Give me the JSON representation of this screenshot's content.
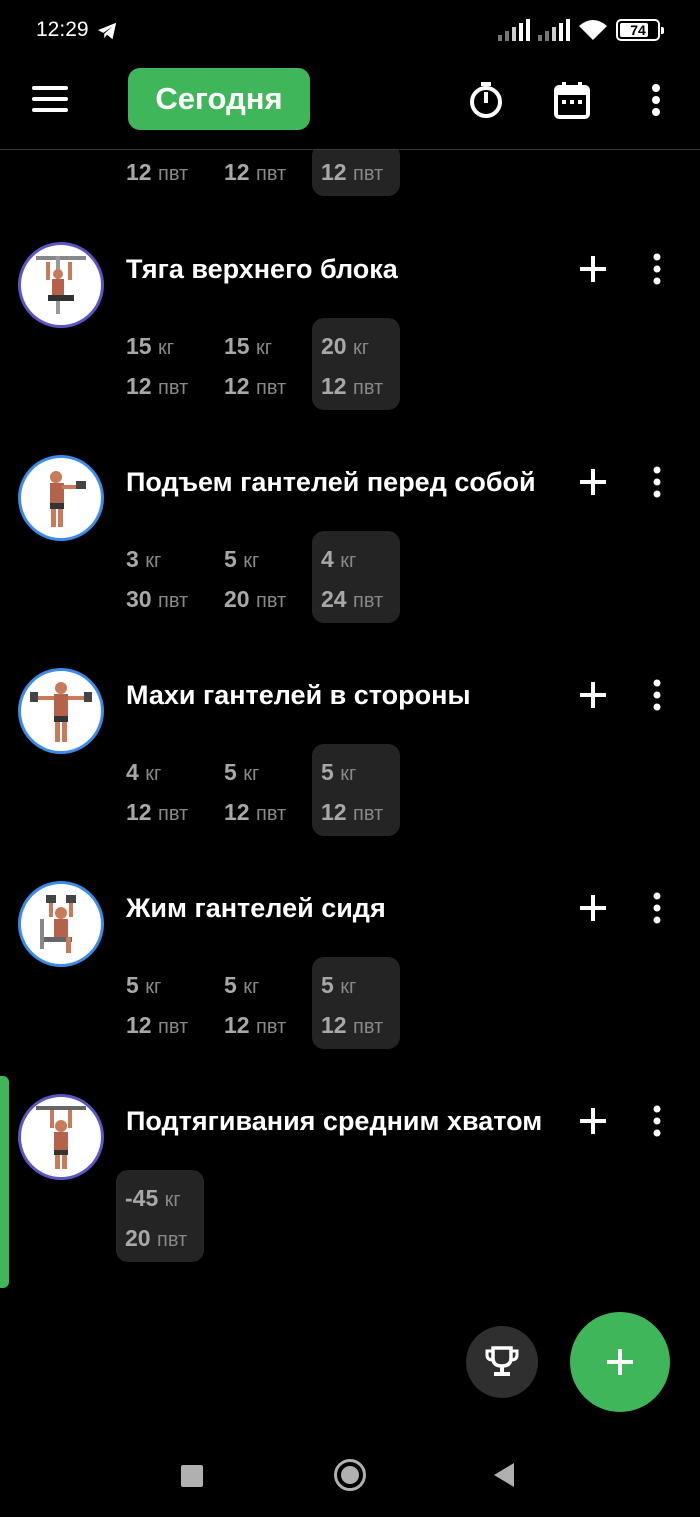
{
  "status_bar": {
    "time": "12:29",
    "battery_level": "74"
  },
  "app_bar": {
    "today_label": "Сегодня"
  },
  "units": {
    "weight": "кг",
    "reps": "пвт"
  },
  "partial_exercise": {
    "sets": [
      {
        "reps": "12"
      },
      {
        "reps": "12"
      },
      {
        "reps": "12"
      }
    ]
  },
  "exercises": [
    {
      "name": "Тяга верхнего блока",
      "sets": [
        {
          "weight": "15",
          "reps": "12"
        },
        {
          "weight": "15",
          "reps": "12"
        },
        {
          "weight": "20",
          "reps": "12"
        }
      ]
    },
    {
      "name": "Подъем гантелей перед собой",
      "sets": [
        {
          "weight": "3",
          "reps": "30"
        },
        {
          "weight": "5",
          "reps": "20"
        },
        {
          "weight": "4",
          "reps": "24"
        }
      ]
    },
    {
      "name": "Махи гантелей в стороны",
      "sets": [
        {
          "weight": "4",
          "reps": "12"
        },
        {
          "weight": "5",
          "reps": "12"
        },
        {
          "weight": "5",
          "reps": "12"
        }
      ]
    },
    {
      "name": "Жим гантелей сидя",
      "sets": [
        {
          "weight": "5",
          "reps": "12"
        },
        {
          "weight": "5",
          "reps": "12"
        },
        {
          "weight": "5",
          "reps": "12"
        }
      ]
    },
    {
      "name": "Подтягивания средним хватом",
      "sets": [
        {
          "weight": "-45",
          "reps": "20"
        }
      ]
    }
  ],
  "colors": {
    "accent": "#3fb65a",
    "background": "#000000",
    "highlight_set": "#242424"
  }
}
